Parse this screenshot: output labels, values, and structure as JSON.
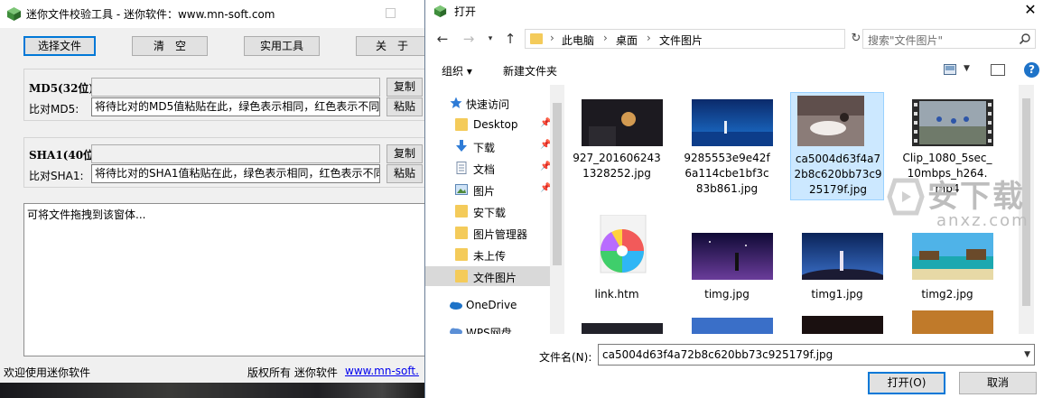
{
  "tool": {
    "title": "迷你文件校验工具 - 迷你软件：www.mn-soft.com",
    "buttons": {
      "choose_file": "选择文件",
      "clear": "清　空",
      "utilities": "实用工具",
      "about": "关　于"
    },
    "md5": {
      "label": "MD5(32位):",
      "compare_label": "比对MD5:",
      "value": "",
      "compare_value": "将待比对的MD5值粘贴在此，绿色表示相同，红色表示不同",
      "copy": "复制",
      "paste": "粘贴"
    },
    "sha1": {
      "label": "SHA1(40位)",
      "compare_label": "比对SHA1:",
      "value": "",
      "compare_value": "将待比对的SHA1值粘贴在此，绿色表示相同，红色表示不同",
      "copy": "复制",
      "paste": "粘贴"
    },
    "drop_hint": "可将文件拖拽到该窗体...",
    "status": {
      "welcome": "欢迎使用迷你软件",
      "copyright": "版权所有 迷你软件",
      "link": "www.mn-soft."
    }
  },
  "dialog": {
    "title": "打开",
    "breadcrumb": [
      "此电脑",
      "桌面",
      "文件图片"
    ],
    "search_placeholder": "搜索\"文件图片\"",
    "toolbar": {
      "organize": "组织 ▾",
      "new_folder": "新建文件夹"
    },
    "nav": [
      {
        "label": "快速访问",
        "icon": "star-icon"
      },
      {
        "label": "Desktop",
        "icon": "desktop-icon"
      },
      {
        "label": "下载",
        "icon": "download-icon"
      },
      {
        "label": "文档",
        "icon": "document-icon"
      },
      {
        "label": "图片",
        "icon": "picture-icon"
      },
      {
        "label": "安下载",
        "icon": "folder-icon"
      },
      {
        "label": "图片管理器",
        "icon": "folder-icon"
      },
      {
        "label": "未上传",
        "icon": "folder-icon"
      },
      {
        "label": "文件图片",
        "icon": "folder-icon"
      },
      {
        "label": "OneDrive",
        "icon": "cloud-icon"
      },
      {
        "label": "WPS网盘",
        "icon": "cloud-icon"
      }
    ],
    "files": [
      {
        "name": "927_201606243 1328252.jpg",
        "thumb": "dark-room"
      },
      {
        "name": "9285553e9e42f 6a114cbe1bf3c 83b861.jpg",
        "thumb": "ocean-night"
      },
      {
        "name": "ca5004d63f4a7 2b8c620bb73c9 25179f.jpg",
        "thumb": "person-photo"
      },
      {
        "name": "Clip_1080_5sec_ 10mbps_h264. mp4",
        "thumb": "video-cyclists"
      },
      {
        "name": "link.htm",
        "thumb": "browser-logo"
      },
      {
        "name": "timg.jpg",
        "thumb": "anime-night"
      },
      {
        "name": "timg1.jpg",
        "thumb": "anime-sky"
      },
      {
        "name": "timg2.jpg",
        "thumb": "tropical-beach"
      }
    ],
    "filename_label": "文件名(N):",
    "filename_value": "ca5004d63f4a72b8c620bb73c925179f.jpg",
    "open": "打开(O)",
    "cancel": "取消"
  },
  "watermark": {
    "text": "安下载",
    "sub": "anxz.com"
  }
}
